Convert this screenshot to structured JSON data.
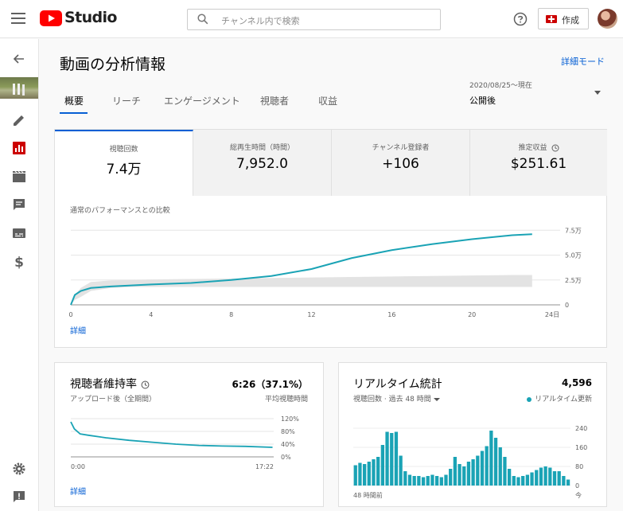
{
  "header": {
    "logo_text": "Studio",
    "search_placeholder": "チャンネル内で検索",
    "create_label": "作成"
  },
  "page": {
    "title": "動画の分析情報",
    "detail_mode": "詳細モード",
    "date_range": "2020/08/25～現在",
    "date_value": "公開後"
  },
  "tabs": [
    "概要",
    "リーチ",
    "エンゲージメント",
    "視聴者",
    "収益"
  ],
  "metrics": [
    {
      "label": "視聴回数",
      "value": "7.4万"
    },
    {
      "label": "総再生時間（時間）",
      "value": "7,952.0"
    },
    {
      "label": "チャンネル登録者",
      "value": "+106"
    },
    {
      "label": "推定収益",
      "value": "$251.61"
    }
  ],
  "main_chart": {
    "compare_label": "通常のパフォーマンスとの比較",
    "more": "詳細"
  },
  "retention": {
    "title": "視聴者維持率",
    "value": "6:26（37.1%）",
    "sub_left": "アップロード後（全期間）",
    "sub_right": "平均視聴時間",
    "more": "詳細"
  },
  "realtime": {
    "title": "リアルタイム統計",
    "value": "4,596",
    "sub_left": "視聴回数 · 過去 48 時間",
    "sub_right": "リアルタイム更新"
  },
  "colors": {
    "accent": "#065fd4",
    "line": "#1aa3b5",
    "brand": "#ff0000"
  },
  "chart_data": [
    {
      "type": "line",
      "title": "",
      "x_ticks": [
        "0",
        "4",
        "8",
        "12",
        "16",
        "20",
        "24日"
      ],
      "y_ticks": [
        "0",
        "2.5万",
        "5.0万",
        "7.5万"
      ],
      "ylim": [
        0,
        80000
      ],
      "series": [
        {
          "x": [
            0,
            0.2,
            0.5,
            1,
            2,
            3,
            4,
            6,
            8,
            10,
            12,
            14,
            16,
            18,
            20,
            22,
            23
          ],
          "values": [
            0,
            10000,
            14000,
            17000,
            18500,
            19500,
            20500,
            22000,
            25000,
            29000,
            36000,
            47000,
            55000,
            61000,
            66000,
            70000,
            71000
          ]
        }
      ],
      "band": {
        "lower": [
          0,
          5000,
          8000,
          14000,
          17000,
          18000,
          18000,
          18000,
          18000,
          18000,
          18000,
          18000,
          18000,
          18000,
          18000,
          18000,
          18000
        ],
        "upper": [
          0,
          10000,
          17000,
          23000,
          24500,
          25000,
          25500,
          26000,
          26500,
          27000,
          27500,
          28000,
          28500,
          29000,
          29500,
          30000,
          30000
        ]
      }
    },
    {
      "type": "line",
      "title": "",
      "x_ticks": [
        "0:00",
        "17:22"
      ],
      "y_ticks": [
        "0%",
        "40%",
        "80%",
        "120%"
      ],
      "ylim": [
        0,
        120
      ],
      "series": [
        {
          "x": [
            0,
            0.3,
            0.8,
            1.5,
            3,
            5,
            7,
            9,
            11,
            13,
            15,
            17.3
          ],
          "values": [
            110,
            88,
            72,
            68,
            60,
            52,
            46,
            40,
            36,
            34,
            33,
            30
          ]
        }
      ]
    },
    {
      "type": "bar",
      "title": "",
      "x_ticks": [
        "48 時間前",
        "今"
      ],
      "y_ticks": [
        "0",
        "80",
        "160",
        "240"
      ],
      "ylim": [
        0,
        240
      ],
      "values": [
        85,
        95,
        90,
        100,
        110,
        120,
        170,
        225,
        220,
        225,
        125,
        60,
        45,
        40,
        40,
        35,
        40,
        45,
        40,
        35,
        45,
        70,
        120,
        90,
        80,
        100,
        110,
        125,
        145,
        165,
        230,
        200,
        160,
        120,
        70,
        40,
        35,
        40,
        45,
        55,
        65,
        75,
        80,
        75,
        60,
        60,
        40,
        25
      ]
    }
  ]
}
